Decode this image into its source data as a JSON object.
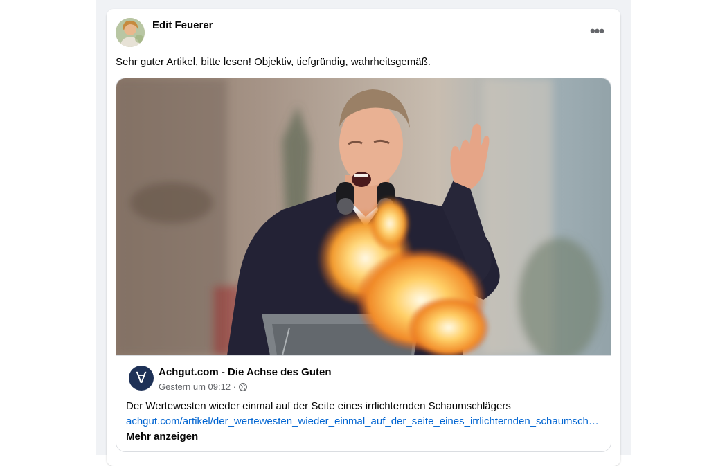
{
  "post": {
    "author": "Edit Feuerer",
    "text": "Sehr guter Artikel, bitte lesen! Objektiv, tiefgründig, wahrheitsgemäß.",
    "more_icon": "ellipsis-icon"
  },
  "link_preview": {
    "source": "Achgut.com - Die Achse des Guten",
    "logo_glyph": "∀",
    "timestamp": "Gestern um 09:12 ·",
    "privacy_icon": "globe-icon",
    "title": "Der Wertewesten wieder einmal auf der Seite eines irrlichternden Schaumschlägers",
    "url": "achgut.com/artikel/der_wertewesten_wieder_einmal_auf_der_seite_eines_irrlichternden_schaumschlaegers",
    "show_more": "Mehr anzeigen"
  },
  "colors": {
    "feed_background": "#f0f2f5",
    "link": "#0064d1",
    "secondary_text": "#65676b",
    "source_logo": "#1e3157"
  }
}
